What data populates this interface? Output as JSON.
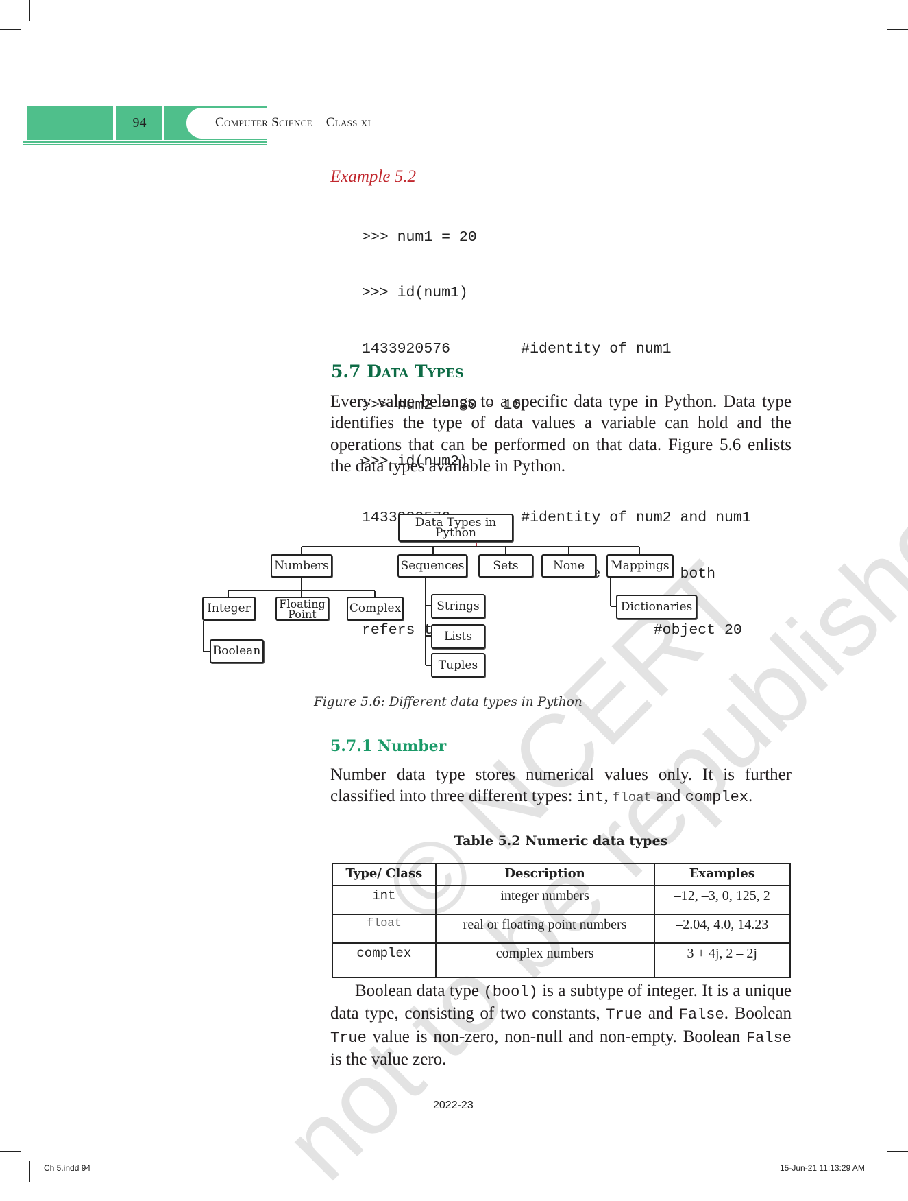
{
  "header": {
    "page_number": "94",
    "running_title": "Computer Science – Class xi",
    "accent_color": "#4fbf8b"
  },
  "example": {
    "label": "Example 5.2",
    "code_lines": [
      ">>> num1 = 20",
      ">>> id(num1)",
      "1433920576        #identity of num1",
      ">>> num2 = 30 - 10",
      ">>> id(num2)",
      "1433920576        #identity of num2 and num1",
      "                       #are same as both",
      "refers to                        #object 20"
    ]
  },
  "section": {
    "heading": "5.7 Data Types",
    "heading_color": "#0d6b45",
    "paragraph": "Every value belongs to a specific data type in Python. Data type identifies the type of data values a variable can hold and the operations that can be performed on that data. Figure 5.6 enlists the data types available in Python."
  },
  "figure": {
    "root": "Data Types in Python",
    "categories": {
      "numbers": "Numbers",
      "sequences": "Sequences",
      "sets": "Sets",
      "none": "None",
      "mappings": "Mappings"
    },
    "numbers_children": {
      "integer": "Integer",
      "floating_1": "Floating",
      "floating_2": "Point",
      "complex": "Complex",
      "boolean": "Boolean"
    },
    "sequences_children": {
      "strings": "Strings",
      "lists": "Lists",
      "tuples": "Tuples"
    },
    "mappings_children": {
      "dictionaries": "Dictionaries"
    },
    "caption": "Figure 5.6:  Different data types in Python"
  },
  "subsection": {
    "heading": "5.7.1 Number",
    "heading_color": "#1a9a68",
    "para_part1": "Number data type stores numerical values only. It is further classified into three different types: ",
    "code_int": "int",
    "sep1": ", ",
    "code_float": "float",
    "sep2": " and ",
    "code_complex": "complex",
    "end": "."
  },
  "table": {
    "title": "Table 5.2  Numeric data types",
    "headers": [
      "Type/ Class",
      "Description",
      "Examples"
    ],
    "rows": [
      {
        "type": "int",
        "description": "integer numbers",
        "examples": "–12, –3, 0, 125, 2"
      },
      {
        "type": "float",
        "description": "real or floating point numbers",
        "examples": "–2.04, 4.0, 14.23"
      },
      {
        "type": "complex",
        "description": "complex numbers",
        "examples": "3 + 4j, 2 – 2j"
      }
    ]
  },
  "boolean_para": {
    "t1": "Boolean data type ",
    "c1": "(bool)",
    "t2": " is a subtype of integer. It is a unique data type, consisting of two constants, ",
    "c2": "True",
    "t3": " and ",
    "c3": "False",
    "t4": ". Boolean ",
    "c4": "True",
    "t5": " value is non-zero, non-null and non-empty. Boolean ",
    "c5": "False",
    "t6": " is the value zero."
  },
  "footer": {
    "year": "2022-23",
    "slug_left": "Ch 5.indd   94",
    "slug_right": "15-Jun-21   11:13:29 AM"
  },
  "watermark": {
    "line1": "© NCERT",
    "line2": "not to be republished"
  }
}
